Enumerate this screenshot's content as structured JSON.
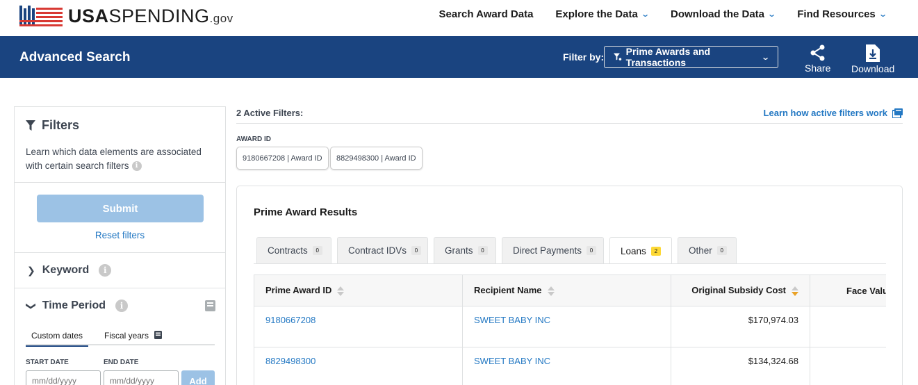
{
  "nav": {
    "logo_bold": "USA",
    "logo_rest": "SPENDING",
    "logo_suffix": ".gov",
    "links": [
      {
        "label": "Search Award Data",
        "has_dropdown": false
      },
      {
        "label": "Explore the Data",
        "has_dropdown": true
      },
      {
        "label": "Download the Data",
        "has_dropdown": true
      },
      {
        "label": "Find Resources",
        "has_dropdown": true
      }
    ]
  },
  "header": {
    "title": "Advanced Search",
    "filter_by_label": "Filter by:",
    "filter_by_value": "Prime Awards and Transactions",
    "share_label": "Share",
    "download_label": "Download"
  },
  "sidebar": {
    "filters_title": "Filters",
    "filters_desc": "Learn which data elements are associated with certain search filters",
    "submit_label": "Submit",
    "reset_label": "Reset filters",
    "keyword_label": "Keyword",
    "time_period_label": "Time Period",
    "tab_custom": "Custom dates",
    "tab_fiscal": "Fiscal years",
    "start_date_label": "START DATE",
    "end_date_label": "END DATE",
    "date_placeholder": "mm/dd/yyyy",
    "add_label": "Add"
  },
  "active_filters": {
    "count_label": "2 Active Filters:",
    "learn_link": "Learn how active filters work",
    "group_label": "AWARD ID",
    "chips": [
      "9180667208 | Award ID",
      "8829498300 | Award ID"
    ]
  },
  "results": {
    "title": "Prime Award Results",
    "tabs": [
      {
        "label": "Contracts",
        "count": "0"
      },
      {
        "label": "Contract IDVs",
        "count": "0"
      },
      {
        "label": "Grants",
        "count": "0"
      },
      {
        "label": "Direct Payments",
        "count": "0"
      },
      {
        "label": "Loans",
        "count": "2"
      },
      {
        "label": "Other",
        "count": "0"
      }
    ],
    "columns": [
      "Prime Award ID",
      "Recipient Name",
      "Original Subsidy Cost",
      "Face Value"
    ],
    "rows": [
      {
        "award_id": "9180667208",
        "recipient": "SWEET BABY INC",
        "subsidy_cost": "$170,974.03",
        "face_value": ""
      },
      {
        "award_id": "8829498300",
        "recipient": "SWEET BABY INC",
        "subsidy_cost": "$134,324.68",
        "face_value": ""
      }
    ]
  },
  "colors": {
    "header_bg": "#1a4480",
    "link": "#2378c3",
    "submit_disabled": "#9cc2e5",
    "count_highlight": "#fdd835"
  }
}
